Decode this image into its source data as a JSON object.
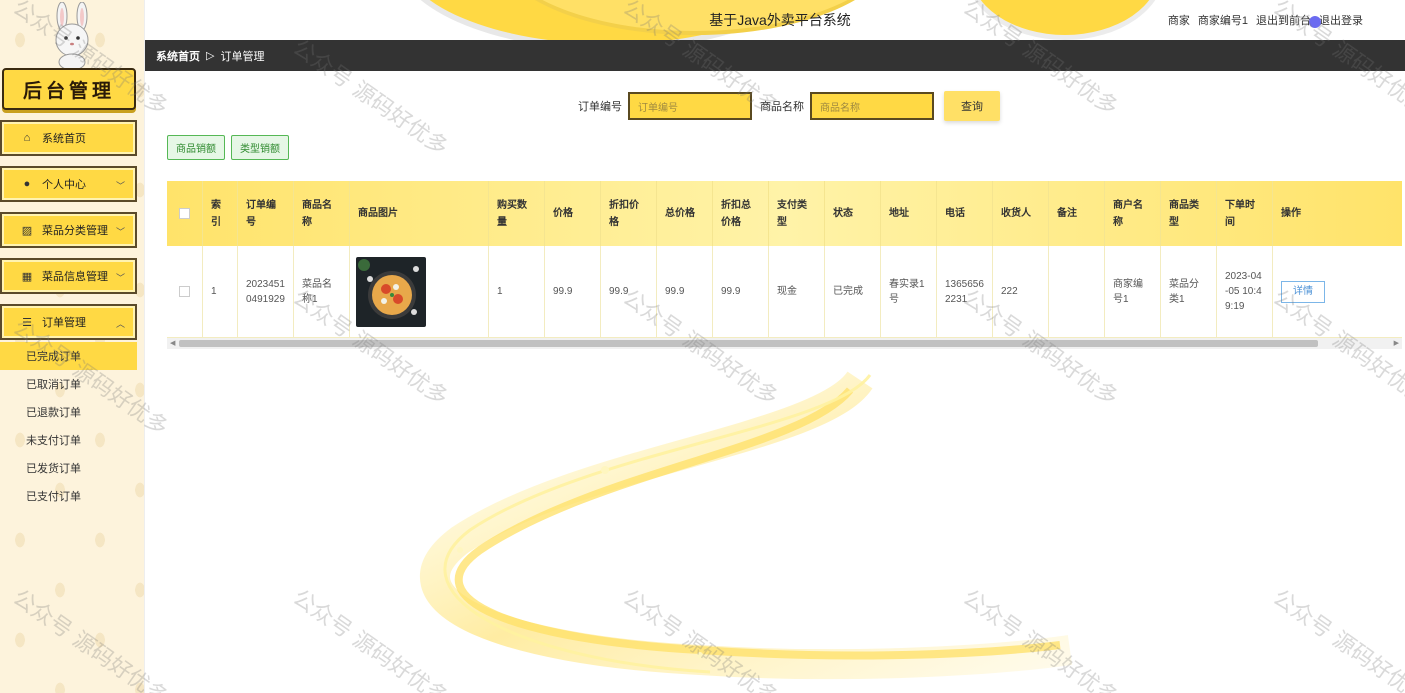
{
  "header": {
    "title": "基于Java外卖平台系统",
    "user_role": "商家",
    "user_name": "商家编号1",
    "exit_front": "退出到前台",
    "logout": "退出登录"
  },
  "sidebar": {
    "logo_text": "后台管理",
    "items": [
      {
        "label": "系统首页",
        "icon": "home-icon"
      },
      {
        "label": "个人中心",
        "icon": "user-icon"
      },
      {
        "label": "菜品分类管理",
        "icon": "chart-icon"
      },
      {
        "label": "菜品信息管理",
        "icon": "grid-icon"
      },
      {
        "label": "订单管理",
        "icon": "list-icon"
      }
    ],
    "submenu": [
      "已完成订单",
      "已取消订单",
      "已退款订单",
      "未支付订单",
      "已发货订单",
      "已支付订单"
    ],
    "active_submenu": "已完成订单"
  },
  "breadcrumb": {
    "home": "系统首页",
    "separator": "▷",
    "current": "订单管理"
  },
  "search": {
    "order_no_label": "订单编号",
    "order_no_placeholder": "订单编号",
    "product_name_label": "商品名称",
    "product_name_placeholder": "商品名称",
    "query_button": "查询"
  },
  "stat_buttons": {
    "product_sales": "商品销额",
    "type_sales": "类型销额"
  },
  "table": {
    "headers": [
      "索引",
      "订单编号",
      "商品名称",
      "商品图片",
      "购买数量",
      "价格",
      "折扣价格",
      "总价格",
      "折扣总价格",
      "支付类型",
      "状态",
      "地址",
      "电话",
      "收货人",
      "备注",
      "商户名称",
      "商品类型",
      "下单时间",
      "操作"
    ],
    "rows": [
      {
        "index": "1",
        "order_no": "20234510491929",
        "product_name": "菜品名称1",
        "quantity": "1",
        "price": "99.9",
        "discount_price": "99.9",
        "total": "99.9",
        "discount_total": "99.9",
        "pay_type": "现金",
        "status": "已完成",
        "address": "春实录1号",
        "phone": "13656562231",
        "receiver": "222",
        "remark": "",
        "merchant": "商家编号1",
        "product_type": "菜品分类1",
        "order_time": "2023-04-05 10:49:19",
        "action": "详情"
      }
    ]
  },
  "watermark": "公众号 源码好优多",
  "colors": {
    "accent": "#ffd944",
    "breadcrumb_bg": "#333333",
    "sidebar_bg": "#fdf3dc"
  }
}
